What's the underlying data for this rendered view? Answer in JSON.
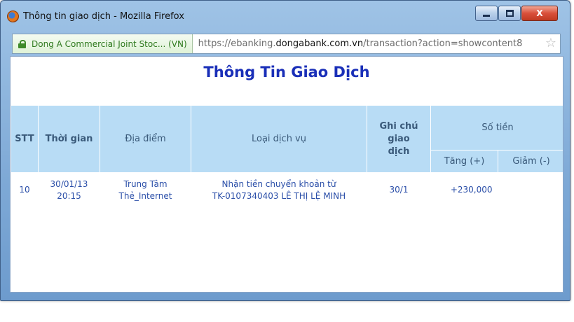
{
  "window": {
    "title": "Thông tin giao dịch - Mozilla Firefox",
    "controls": {
      "minimize": "",
      "maximize": "",
      "close": "X"
    }
  },
  "urlbar": {
    "identity": "Dong A Commercial Joint Stoc... (VN)",
    "url_prefix": "https://ebanking.",
    "url_domain": "dongabank.com.vn",
    "url_suffix": "/transaction?action=showcontent8"
  },
  "page": {
    "title": "Thông Tin Giao Dịch"
  },
  "table": {
    "headers": {
      "stt": "STT",
      "time": "Thời gian",
      "place": "Địa điểm",
      "service": "Loại dịch vụ",
      "note": "Ghi chú giao dịch",
      "amount": "Số tiền",
      "increase": "Tăng (+)",
      "decrease": "Giảm (-)"
    },
    "rows": [
      {
        "stt": "10",
        "date": "30/01/13",
        "time": "20:15",
        "place_line1": "Trung Tâm",
        "place_line2": "Thẻ_Internet",
        "service_line1": "Nhận tiền chuyển khoản từ",
        "service_line2": "TK-0107340403 LÊ THỊ LỆ MINH",
        "note": "30/1",
        "increase": "+230,000",
        "decrease": ""
      }
    ]
  },
  "colors": {
    "title_blue": "#1a2fb8",
    "header_bg": "#b8dcf5",
    "cell_text": "#2a4ea8"
  }
}
